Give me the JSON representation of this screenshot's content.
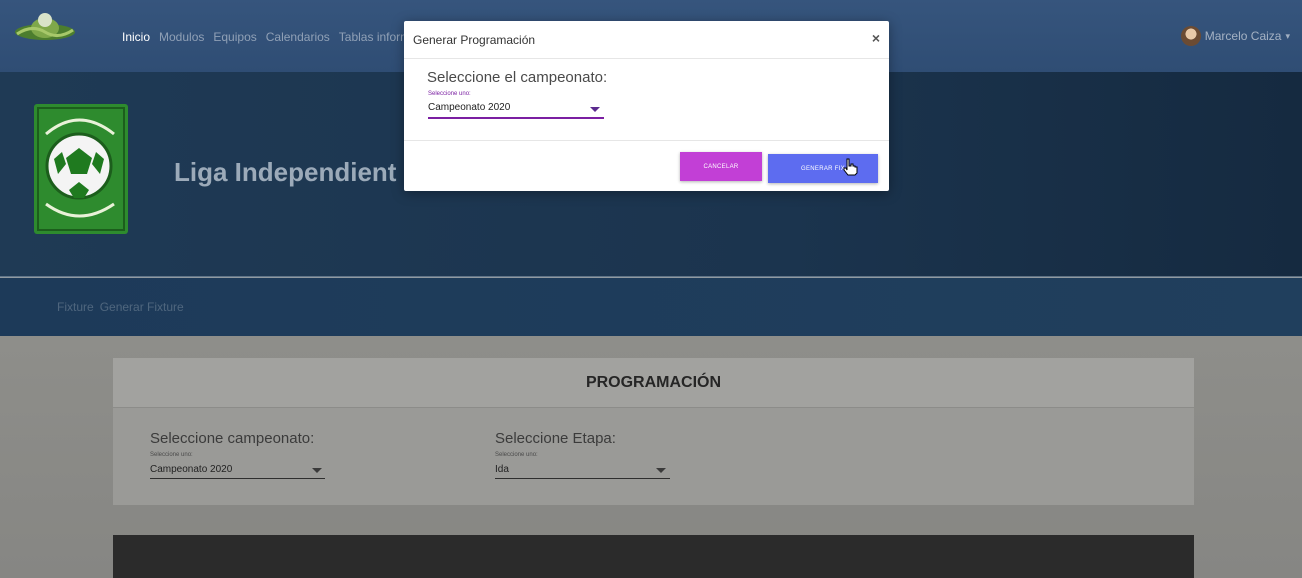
{
  "navbar": {
    "links": [
      "Inicio",
      "Modulos",
      "Equipos",
      "Calendarios",
      "Tablas inform"
    ],
    "user_name": "Marcelo Caiza",
    "user_caret": "▾"
  },
  "hero": {
    "title": "Liga Independient"
  },
  "breadcrumb": [
    "Fixture",
    "Generar Fixture"
  ],
  "card": {
    "title": "PROGRAMACIÓN",
    "campeonato": {
      "label": "Seleccione campeonato:",
      "hint": "Seleccione uno:",
      "value": "Campeonato 2020"
    },
    "etapa": {
      "label": "Seleccione Etapa:",
      "hint": "Seleccione uno:",
      "value": "Ida"
    }
  },
  "modal": {
    "title": "Generar Programación",
    "close_glyph": "×",
    "label": "Seleccione el campeonato:",
    "hint": "Seleccione uno:",
    "value": "Campeonato 2020",
    "cancel_label": "CANCELAR",
    "generate_label": "GENERAR FIX"
  },
  "colors": {
    "navbar": "#36557d",
    "modal_accent": "#7b1fa2",
    "cancel_button": "#c23fd6",
    "generate_button": "#5d6cf0"
  },
  "icons": [
    "league-logo-icon",
    "user-avatar-icon",
    "dropdown-caret-icon",
    "close-icon",
    "hand-cursor-icon"
  ]
}
